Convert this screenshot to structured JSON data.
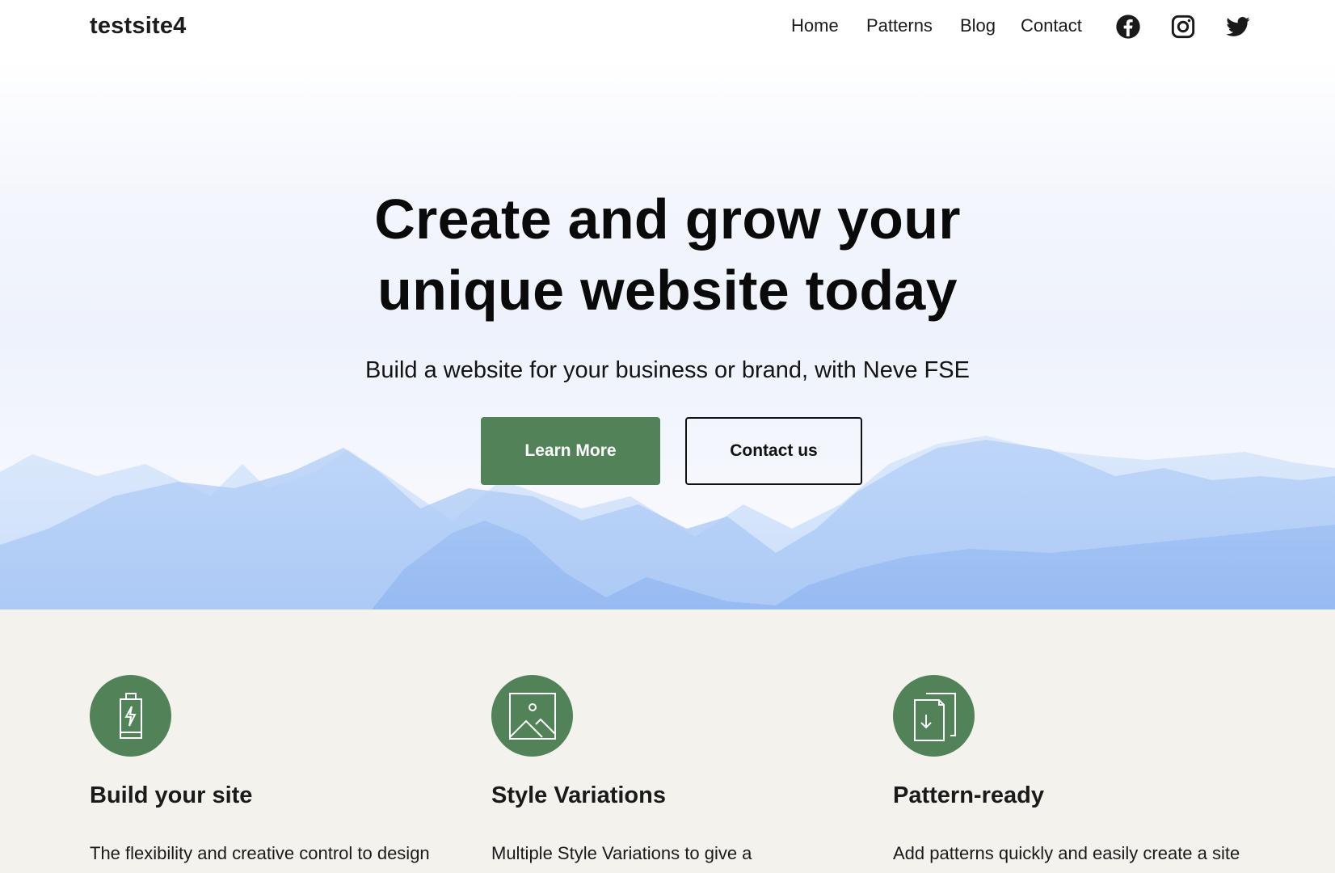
{
  "header": {
    "logo": "testsite4",
    "nav": [
      {
        "label": "Home"
      },
      {
        "label": "Patterns"
      },
      {
        "label": "Blog"
      },
      {
        "label": "Contact"
      }
    ],
    "social": [
      {
        "icon": "facebook-icon"
      },
      {
        "icon": "instagram-icon"
      },
      {
        "icon": "twitter-icon"
      }
    ]
  },
  "hero": {
    "title_line1": "Create and grow your",
    "title_line2": "unique website today",
    "subtitle": "Build a website for your business or brand, with Neve FSE",
    "primary_button": "Learn More",
    "secondary_button": "Contact us"
  },
  "features": [
    {
      "icon": "battery-charging-icon",
      "title": "Build your site",
      "text": "The flexibility and creative control to design"
    },
    {
      "icon": "image-icon",
      "title": "Style Variations",
      "text": "Multiple Style Variations to give a"
    },
    {
      "icon": "documents-download-icon",
      "title": "Pattern-ready",
      "text": "Add patterns quickly and easily create a site"
    }
  ],
  "colors": {
    "accent": "#528358",
    "features_bg": "#f4f2ed",
    "text": "#111111"
  }
}
